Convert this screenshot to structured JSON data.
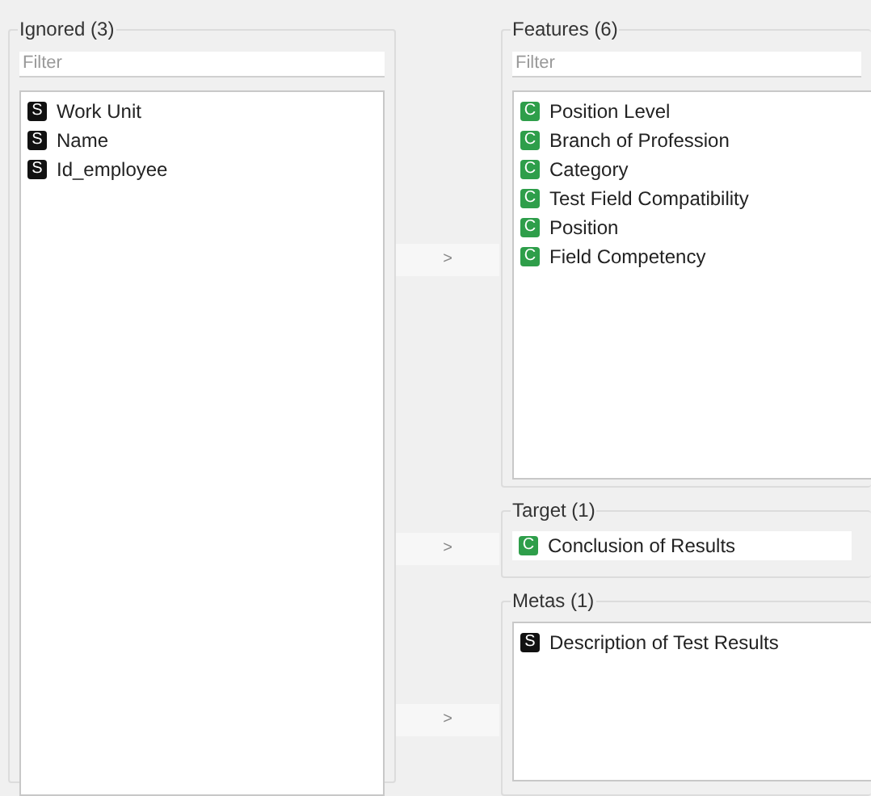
{
  "ignored": {
    "title": "Ignored (3)",
    "filter": {
      "placeholder": "Filter"
    },
    "items": [
      {
        "kind": "string",
        "badge": "S",
        "label": "Work Unit"
      },
      {
        "kind": "string",
        "badge": "S",
        "label": "Name"
      },
      {
        "kind": "string",
        "badge": "S",
        "label": "Id_employee"
      }
    ]
  },
  "features": {
    "title": "Features (6)",
    "button": ">",
    "filter": {
      "placeholder": "Filter"
    },
    "items": [
      {
        "kind": "continuous",
        "badge": "C",
        "label": "Position Level"
      },
      {
        "kind": "continuous",
        "badge": "C",
        "label": "Branch of Profession"
      },
      {
        "kind": "continuous",
        "badge": "C",
        "label": "Category"
      },
      {
        "kind": "continuous",
        "badge": "C",
        "label": "Test Field Compatibility"
      },
      {
        "kind": "continuous",
        "badge": "C",
        "label": "Position"
      },
      {
        "kind": "continuous",
        "badge": "C",
        "label": "Field Competency"
      }
    ]
  },
  "target": {
    "title": "Target (1)",
    "button": ">",
    "items": [
      {
        "kind": "continuous",
        "badge": "C",
        "label": "Conclusion of Results"
      }
    ]
  },
  "metas": {
    "title": "Metas (1)",
    "button": ">",
    "items": [
      {
        "kind": "string",
        "badge": "S",
        "label": "Description of Test Results"
      }
    ]
  }
}
